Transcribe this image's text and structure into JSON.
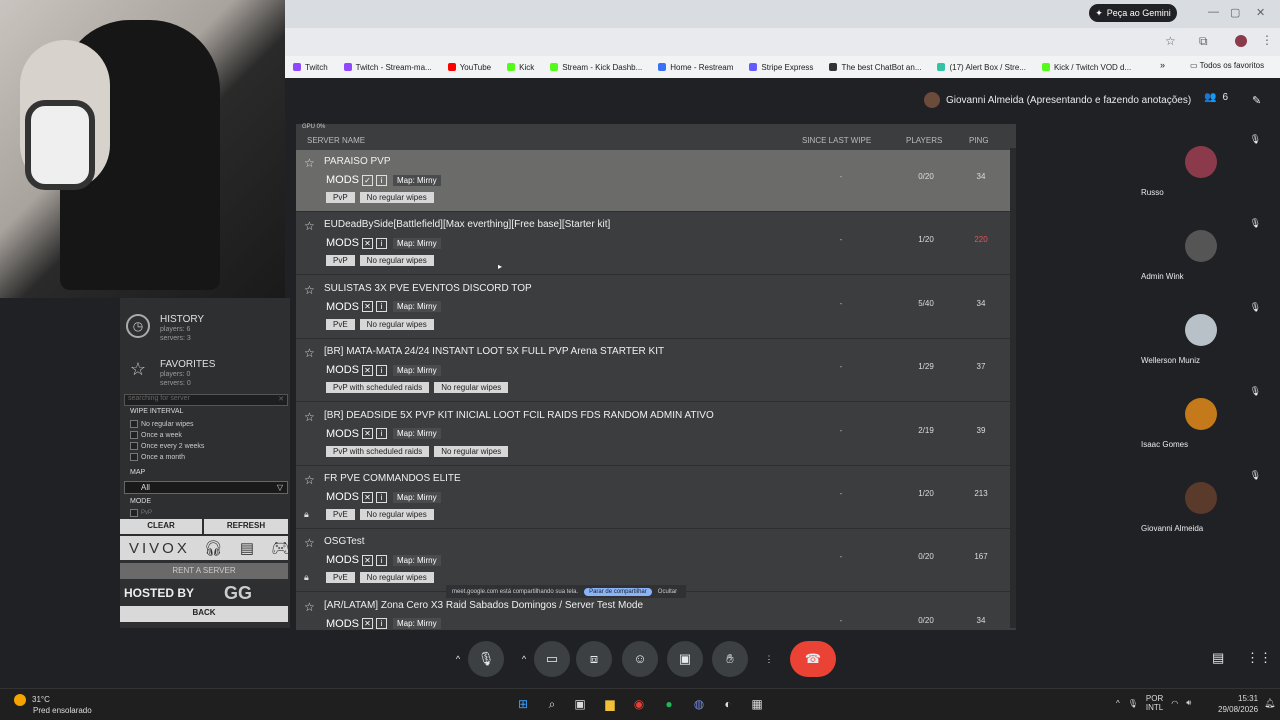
{
  "browser": {
    "gemini_label": "Peça ao Gemini",
    "all_bookmarks": "Todos os favoritos",
    "bookmarks": [
      {
        "label": "Twitch",
        "color": "#9146ff"
      },
      {
        "label": "Twitch - Stream-ma...",
        "color": "#9146ff"
      },
      {
        "label": "YouTube",
        "color": "#ff0000"
      },
      {
        "label": "Kick",
        "color": "#53fc18"
      },
      {
        "label": "Stream - Kick Dashb...",
        "color": "#53fc18"
      },
      {
        "label": "Home - Restream",
        "color": "#3a6ff8"
      },
      {
        "label": "Stripe Express",
        "color": "#635bff"
      },
      {
        "label": "The best ChatBot an...",
        "color": "#333333"
      },
      {
        "label": "(17) Alert Box / Stre...",
        "color": "#31c3a2"
      },
      {
        "label": "Kick / Twitch VOD d...",
        "color": "#53fc18"
      }
    ]
  },
  "meet": {
    "presenter": "Giovanni Almeida (Apresentando e fazendo anotações)",
    "participant_count": "6",
    "participants": [
      {
        "name": "Russo",
        "color": "#8a3a4a"
      },
      {
        "name": "Admin Wink",
        "color": "#555555"
      },
      {
        "name": "Wellerson Muniz",
        "color": "#b8c0c8"
      },
      {
        "name": "Isaac Gomes",
        "color": "#c47a1a"
      },
      {
        "name": "Giovanni Almeida",
        "color": "#5a3a2a"
      }
    ],
    "share_text": "meet.google.com está compartilhando sua tela.",
    "share_stop": "Parar de compartilhar",
    "share_hide": "Ocultar"
  },
  "launcher": {
    "gpu": "GPU 0%",
    "history": {
      "title": "HISTORY",
      "players": "players: 6",
      "servers": "servers: 3"
    },
    "favorites": {
      "title": "FAVORITES",
      "players": "players: 0",
      "servers": "servers: 0"
    },
    "search_placeholder": "searching for server",
    "wipe_interval_label": "WIPE INTERVAL",
    "wipe_options": [
      "No regular wipes",
      "Once a week",
      "Once every 2 weeks",
      "Once a month"
    ],
    "map_label": "MAP",
    "map_value": "All",
    "mode_label": "MODE",
    "mode_partial": "PvP",
    "clear": "CLEAR",
    "refresh": "REFRESH",
    "vivox": "VIVOX",
    "rent": "RENT A SERVER",
    "hosted_by": "HOSTED BY",
    "gg": "GG",
    "back": "BACK",
    "columns": {
      "name": "SERVER NAME",
      "wipe": "SINCE LAST WIPE",
      "players": "PLAYERS",
      "ping": "PING"
    },
    "servers": [
      {
        "name": "PARAISO PVP",
        "mods": "MODS",
        "map": "Map: Mirny",
        "tags": [
          "PvP",
          "No regular wipes"
        ],
        "wipe": "-",
        "players": "0/20",
        "ping": "34",
        "selected": true,
        "locked": false
      },
      {
        "name": "EUDeadBySide[Battlefield][Max everthing][Free base][Starter kit]",
        "mods": "MODS",
        "map": "Map: Mirny",
        "tags": [
          "PvP",
          "No regular wipes"
        ],
        "wipe": "-",
        "players": "1/20",
        "ping": "220",
        "selected": false,
        "locked": false
      },
      {
        "name": "SULISTAS 3X PVE EVENTOS DISCORD TOP",
        "mods": "MODS",
        "map": "Map: Mirny",
        "tags": [
          "PvE",
          "No regular wipes"
        ],
        "wipe": "-",
        "players": "5/40",
        "ping": "34",
        "selected": false,
        "locked": false
      },
      {
        "name": "[BR] MATA-MATA 24/24 INSTANT LOOT 5X FULL PVP Arena STARTER KIT",
        "mods": "MODS",
        "map": "Map: Mirny",
        "tags": [
          "PvP with scheduled raids",
          "No regular wipes"
        ],
        "wipe": "-",
        "players": "1/29",
        "ping": "37",
        "selected": false,
        "locked": false
      },
      {
        "name": "[BR] DEADSIDE 5X PVP KIT INICIAL LOOT FCIL RAIDS FDS RANDOM ADMIN ATIVO",
        "mods": "MODS",
        "map": "Map: Mirny",
        "tags": [
          "PvP with scheduled raids",
          "No regular wipes"
        ],
        "wipe": "-",
        "players": "2/19",
        "ping": "39",
        "selected": false,
        "locked": false
      },
      {
        "name": "FR PVE COMMANDOS ELITE",
        "mods": "MODS",
        "map": "Map: Mirny",
        "tags": [
          "PvE",
          "No regular wipes"
        ],
        "wipe": "-",
        "players": "1/20",
        "ping": "213",
        "selected": false,
        "locked": true
      },
      {
        "name": "OSGTest",
        "mods": "MODS",
        "map": "Map: Mirny",
        "tags": [
          "PvE",
          "No regular wipes"
        ],
        "wipe": "-",
        "players": "0/20",
        "ping": "167",
        "selected": false,
        "locked": true
      },
      {
        "name": "[AR/LATAM] Zona Cero X3 Raid Sabados Domingos / Server Test Mode",
        "mods": "MODS",
        "map": "Map: Mirny",
        "tags": [],
        "wipe": "-",
        "players": "0/20",
        "ping": "34",
        "selected": false,
        "locked": false
      }
    ]
  },
  "taskbar": {
    "temp": "31°C",
    "weather": "Pred ensolarado",
    "lang1": "POR",
    "lang2": "INTL",
    "time": "15:31",
    "date": "29/08/2026"
  }
}
